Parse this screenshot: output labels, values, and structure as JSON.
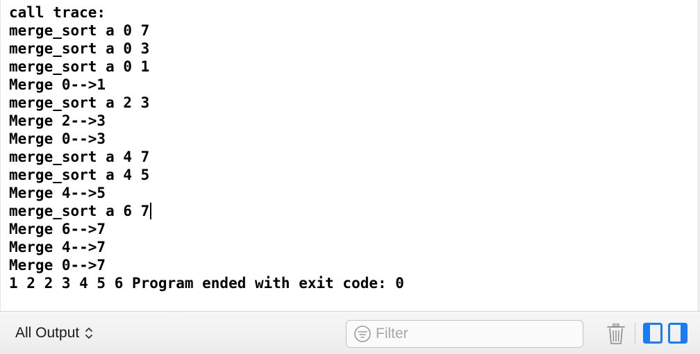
{
  "console": {
    "lines": [
      "call trace:",
      "merge_sort a 0 7",
      "merge_sort a 0 3",
      "merge_sort a 0 1",
      "Merge 0-->1",
      "merge_sort a 2 3",
      "Merge 2-->3",
      "Merge 0-->3",
      "merge_sort a 4 7",
      "merge_sort a 4 5",
      "Merge 4-->5",
      "merge_sort a 6 7",
      "Merge 6-->7",
      "Merge 4-->7",
      "Merge 0-->7",
      "1 2 2 3 4 5 6 Program ended with exit code: 0"
    ]
  },
  "bottom_bar": {
    "output_selector_label": "All Output",
    "filter_placeholder": "Filter",
    "icons": {
      "selector": "up-down-chevron-icon",
      "filter": "filter-icon",
      "trash": "trash-icon",
      "left_pane": "left-pane-icon",
      "right_pane": "right-pane-icon"
    },
    "accent_color": "#1a7cf5"
  }
}
